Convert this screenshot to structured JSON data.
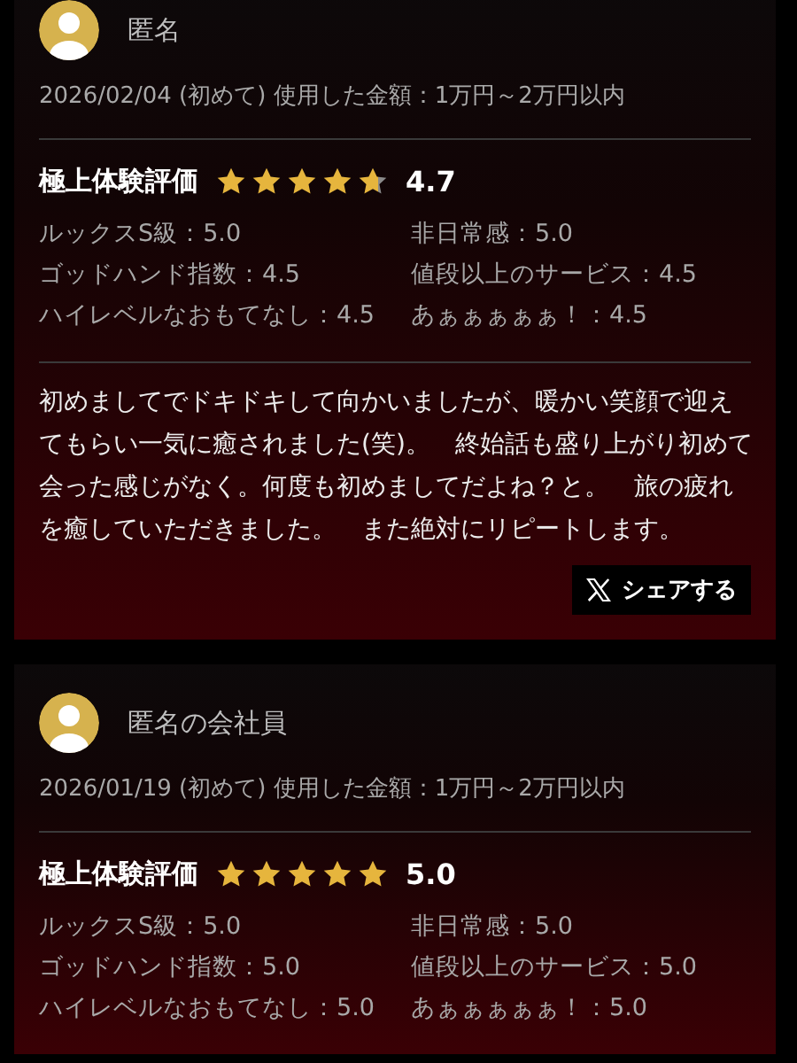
{
  "reviews": [
    {
      "name": "匿名",
      "meta": "2026/02/04 (初めて) 使用した金額：1万円～2万円以内",
      "rating_label": "極上体験評価",
      "stars": 4.7,
      "score": "4.7",
      "scores": [
        "ルックスS級：5.0",
        "非日常感：5.0",
        "ゴッドハンド指数：4.5",
        "値段以上のサービス：4.5",
        "ハイレベルなおもてなし：4.5",
        "あぁぁぁぁぁ！：4.5"
      ],
      "comment": "初めましてでドキドキして向かいましたが、暖かい笑顔で迎えてもらい一気に癒されました(笑)。　終始話も盛り上がり初めて会った感じがなく。何度も初めましてだよね？と。　旅の疲れを癒していただきました。　また絶対にリピートします。",
      "share_button": "シェアする"
    },
    {
      "name": "匿名の会社員",
      "meta": "2026/01/19 (初めて) 使用した金額：1万円～2万円以内",
      "rating_label": "極上体験評価",
      "stars": 5,
      "score": "5.0",
      "scores": [
        "ルックスS級：5.0",
        "非日常感：5.0",
        "ゴッドハンド指数：5.0",
        "値段以上のサービス：5.0",
        "ハイレベルなおもてなし：5.0",
        "あぁぁぁぁぁ！：5.0"
      ]
    }
  ]
}
